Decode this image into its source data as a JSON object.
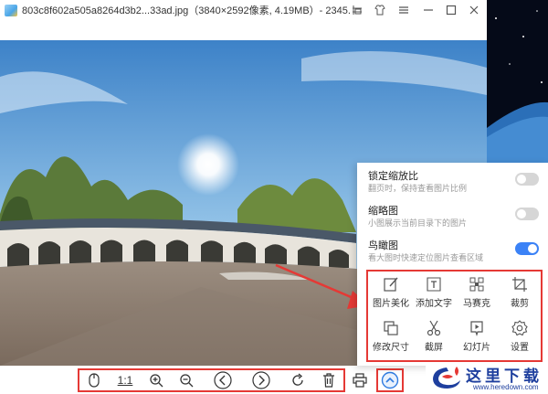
{
  "window": {
    "title": "803c8f602a505a8264d3b2...33ad.jpg（3840×2592像素, 4.19MB）- 2345..."
  },
  "menu": {
    "items": [
      {
        "label": "锁定缩放比",
        "desc": "翻页时，保持查看图片比例",
        "enabled": false
      },
      {
        "label": "缩略图",
        "desc": "小图展示当前目录下的图片",
        "enabled": false
      },
      {
        "label": "鸟瞰图",
        "desc": "看大图时快速定位图片查看区域",
        "enabled": true
      }
    ],
    "tools": [
      {
        "label": "图片美化",
        "icon": "edit-icon"
      },
      {
        "label": "添加文字",
        "icon": "add-text-icon"
      },
      {
        "label": "马赛克",
        "icon": "mosaic-icon"
      },
      {
        "label": "裁剪",
        "icon": "crop-icon"
      },
      {
        "label": "修改尺寸",
        "icon": "resize-icon"
      },
      {
        "label": "截屏",
        "icon": "scissors-icon"
      },
      {
        "label": "幻灯片",
        "icon": "slideshow-icon"
      },
      {
        "label": "设置",
        "icon": "gear-icon"
      }
    ]
  },
  "toolbar": {
    "actual_size_label": "1:1",
    "buttons": [
      "mouse-icon",
      "actual-size",
      "zoom-in-icon",
      "zoom-out-icon",
      "prev-icon",
      "next-icon",
      "rotate-icon",
      "delete-icon",
      "print-icon",
      "more-up-icon"
    ]
  },
  "watermark": {
    "name": "这里下载",
    "url": "www.heredown.com"
  },
  "colors": {
    "highlight": "#e53935",
    "toggle_on": "#3b82f6",
    "toggle_off": "#d6d6d6",
    "logo": "#1e3f9e"
  }
}
